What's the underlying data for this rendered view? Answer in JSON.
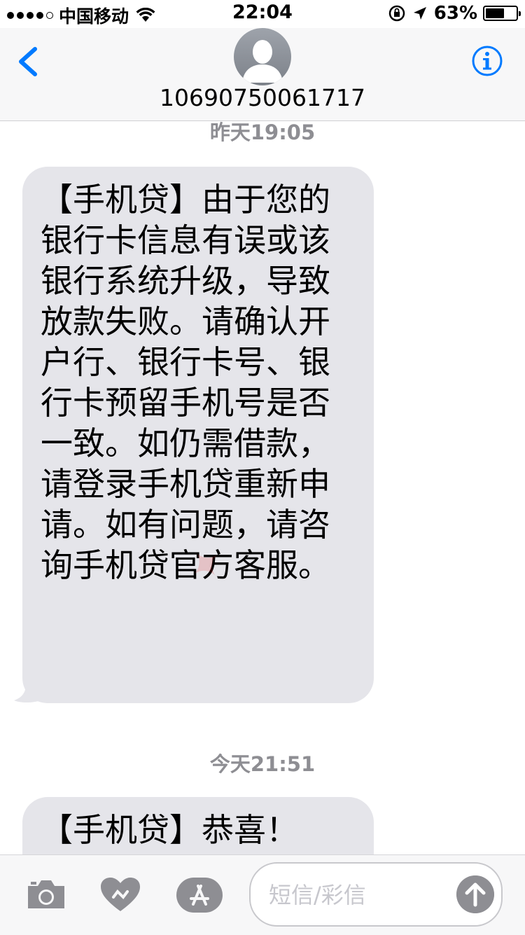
{
  "status_bar": {
    "carrier": "中国移动",
    "time": "22:04",
    "battery_percent": "63%",
    "battery_level": 0.63
  },
  "header": {
    "contact": "10690750061717",
    "back_icon": "chevron-left-icon",
    "info_icon": "info-icon"
  },
  "messages": [
    {
      "timestamp": "昨天19:05",
      "text": "【手机贷】由于您的银行卡信息有误或该银行系统升级，导致放款失败。请确认开户行、银行卡号、银行卡预留手机号是否一致。如仍需借款，请登录手机贷重新申请。如有问题，请咨询手机贷官方客服。"
    },
    {
      "timestamp": "今天21:51",
      "text": "【手机贷】恭喜！"
    }
  ],
  "input_bar": {
    "placeholder": "短信/彩信",
    "icons": [
      "camera-icon",
      "digital-touch-icon",
      "app-store-icon",
      "send-arrow-icon"
    ]
  },
  "colors": {
    "accent": "#007aff",
    "bubble_received": "#e5e5ea",
    "timestamp": "#8e8e93"
  }
}
